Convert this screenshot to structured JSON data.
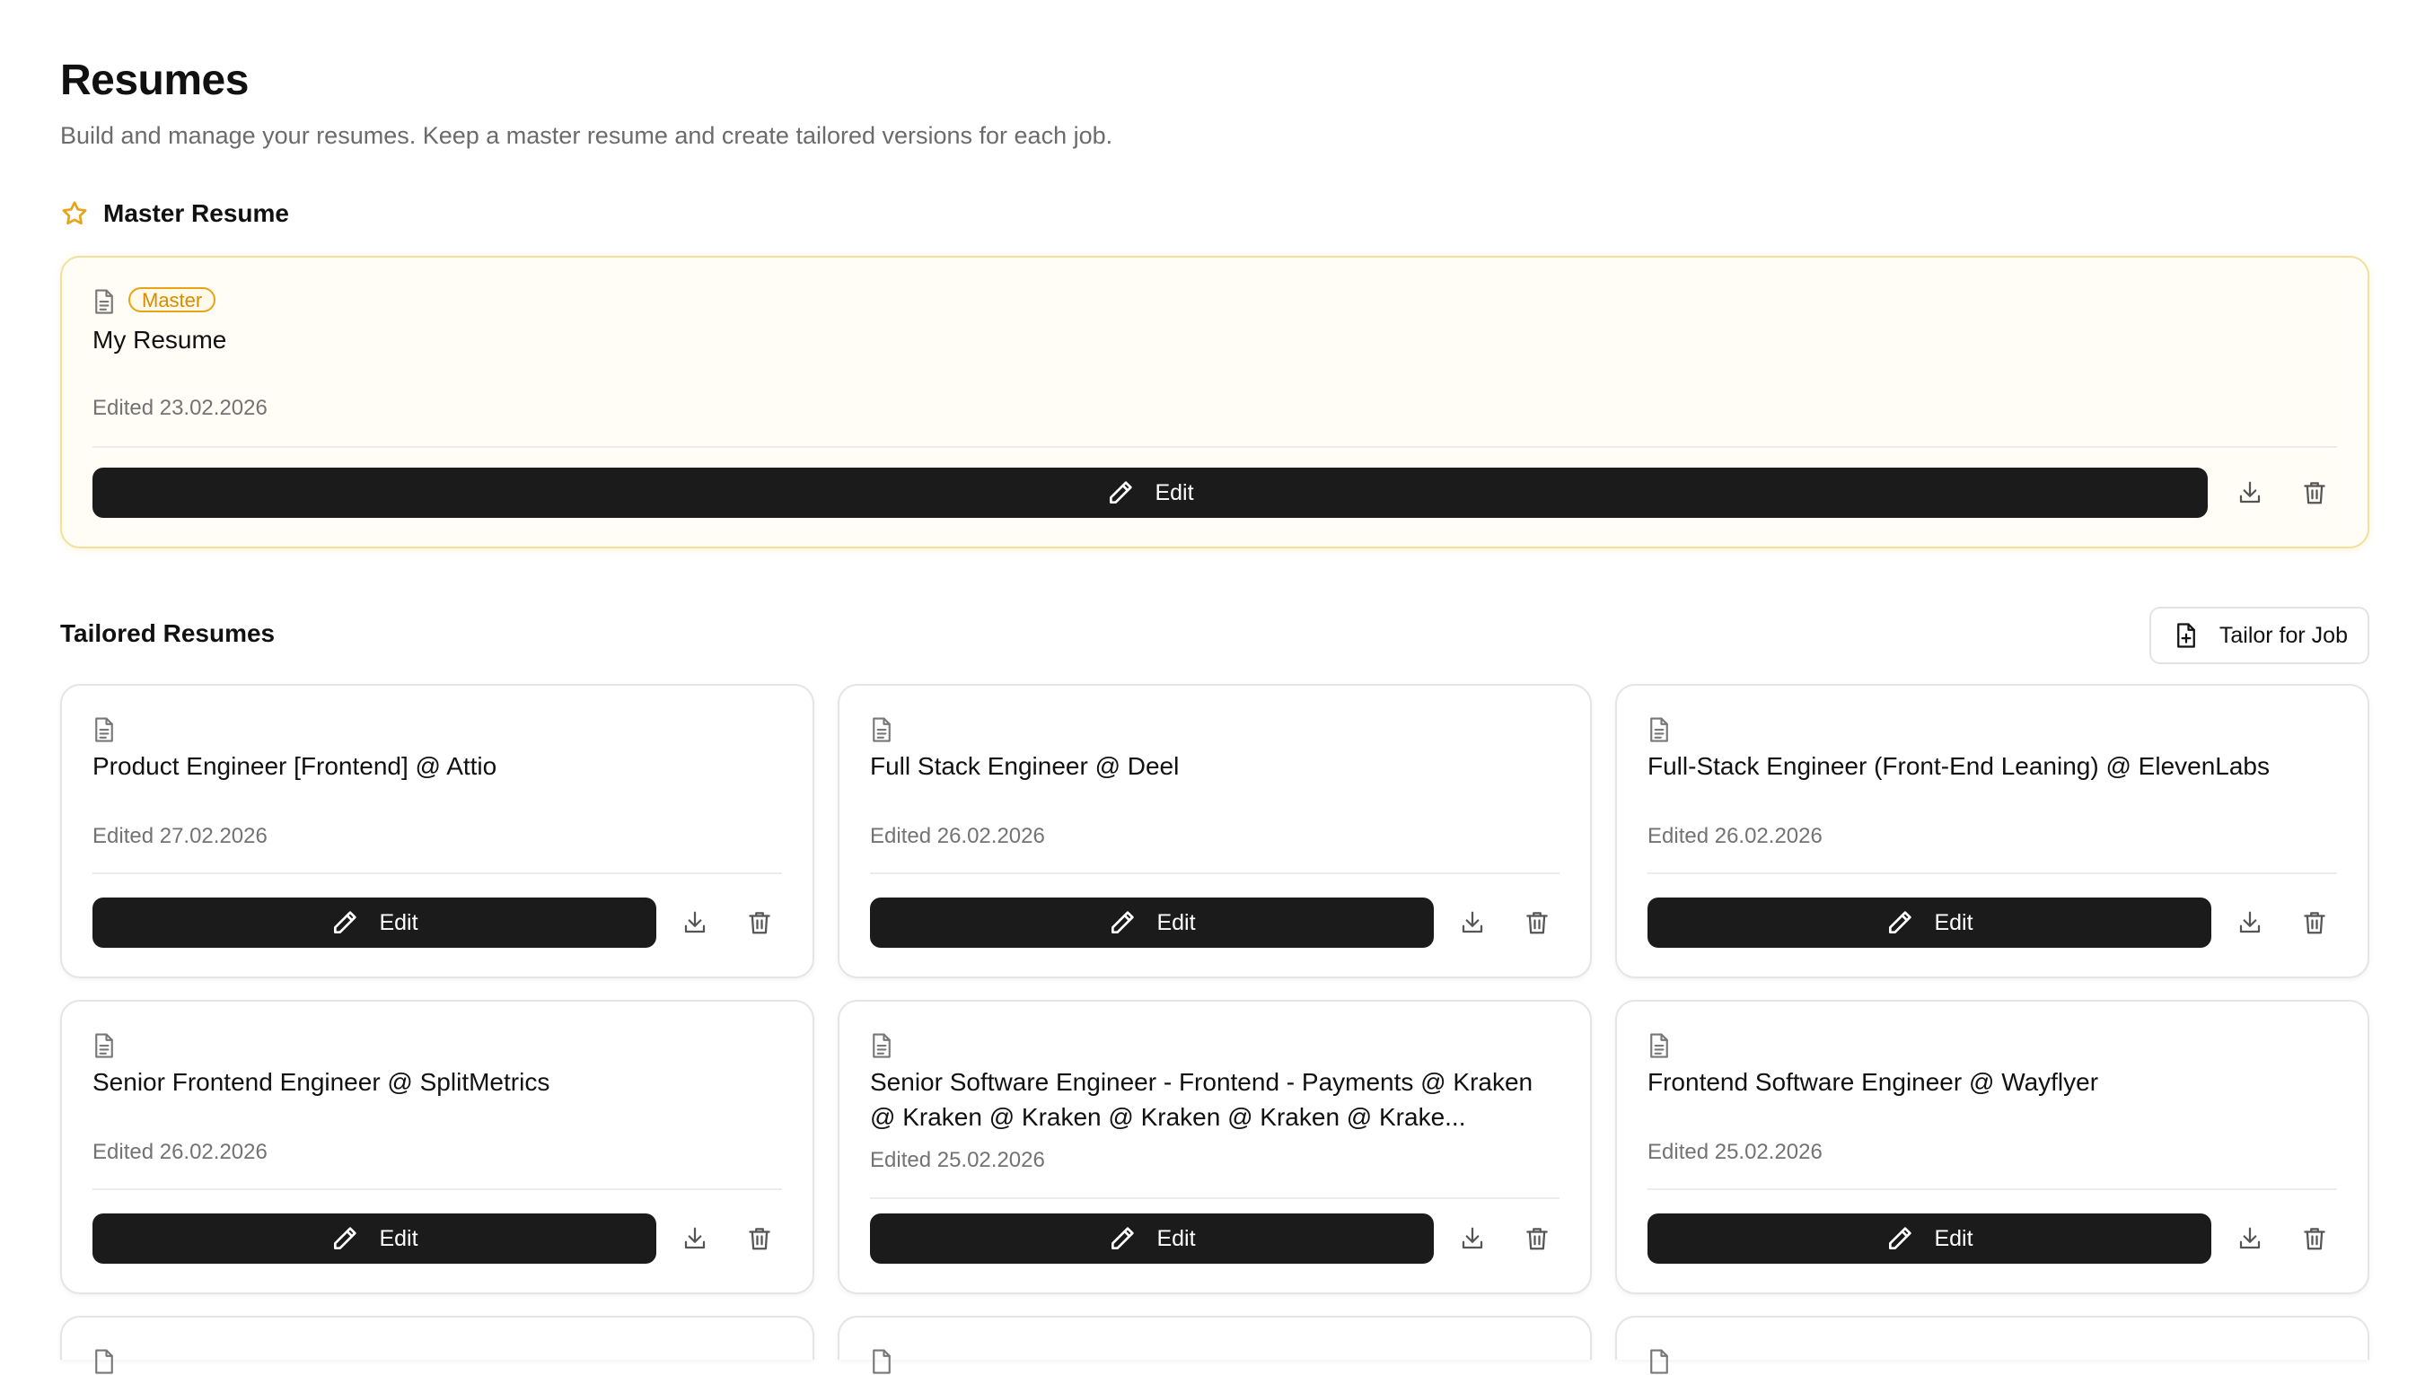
{
  "header": {
    "title": "Resumes",
    "subtitle": "Build and manage your resumes. Keep a master resume and create tailored versions for each job."
  },
  "master_section": {
    "heading": "Master Resume",
    "icon": "star-icon",
    "card": {
      "badge": "Master",
      "title": "My Resume",
      "edited": "Edited 23.02.2026",
      "edit_label": "Edit"
    }
  },
  "tailored_section": {
    "heading": "Tailored Resumes",
    "tailor_button": "Tailor for Job",
    "cards": [
      {
        "title": "Product Engineer [Frontend] @ Attio",
        "edited": "Edited 27.02.2026",
        "edit_label": "Edit"
      },
      {
        "title": "Full Stack Engineer @ Deel",
        "edited": "Edited 26.02.2026",
        "edit_label": "Edit"
      },
      {
        "title": "Full-Stack Engineer (Front-End Leaning) @ ElevenLabs",
        "edited": "Edited 26.02.2026",
        "edit_label": "Edit"
      },
      {
        "title": "Senior Frontend Engineer @ SplitMetrics",
        "edited": "Edited 26.02.2026",
        "edit_label": "Edit"
      },
      {
        "title": "Senior Software Engineer - Frontend - Payments @ Kraken @ Kraken @ Kraken @ Kraken @ Kraken @ Krake...",
        "edited": "Edited 25.02.2026",
        "edit_label": "Edit"
      },
      {
        "title": "Frontend Software Engineer @ Wayflyer",
        "edited": "Edited 25.02.2026",
        "edit_label": "Edit"
      }
    ]
  },
  "colors": {
    "accent_master": "#e8a317",
    "button_dark": "#1b1b1b",
    "muted_text": "#737373"
  }
}
